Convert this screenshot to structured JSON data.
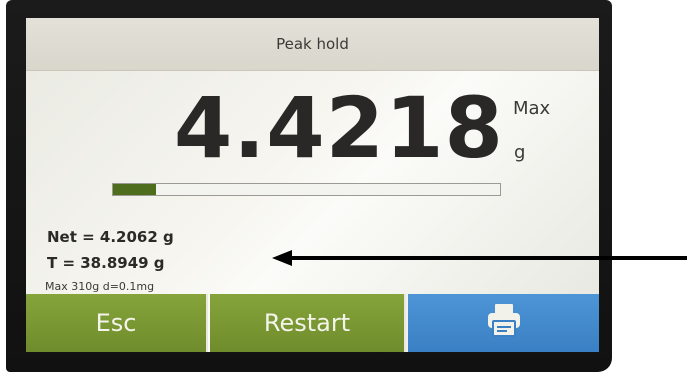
{
  "header": {
    "title": "Peak hold"
  },
  "reading": {
    "value": "4.4218",
    "mode": "Max",
    "unit": "g",
    "capacity_fraction": 0.11
  },
  "info": {
    "net": "Net = 4.2062 g",
    "tare": "T = 38.8949 g",
    "spec": "Max 310g   d=0.1mg"
  },
  "buttons": {
    "esc_label": "Esc",
    "restart_label": "Restart",
    "print_icon": "printer-icon"
  },
  "colors": {
    "green_button": "#7a9a33",
    "blue_button": "#4a8fd0",
    "bar_fill": "#4e6e1e"
  }
}
